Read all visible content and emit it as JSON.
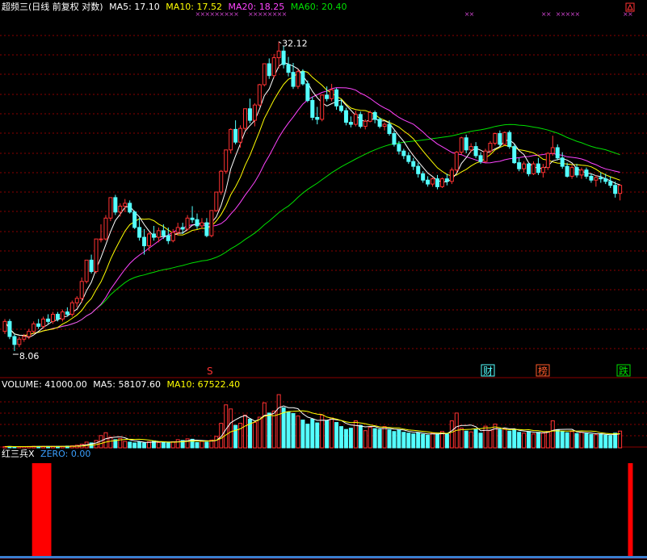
{
  "header": {
    "stock_title": "超频三(日线 前复权 对数)",
    "ma5_label": "MA5: 17.10",
    "ma10_label": "MA10: 17.52",
    "ma20_label": "MA20: 18.25",
    "ma60_label": "MA60: 20.40"
  },
  "price_panel": {
    "high_label": "32.12",
    "low_label": "8.06",
    "markers": [
      {
        "text": "S"
      },
      {
        "text": "财"
      },
      {
        "text": "榜"
      },
      {
        "text": "跌"
      }
    ]
  },
  "volume_header": {
    "volume_label": "VOLUME: 41000.00",
    "ma5_label": "MA5: 58107.60",
    "ma10_label": "MA10: 67522.40"
  },
  "indicator_header": {
    "name": "红三兵",
    "close_mark": "X",
    "zero_label": "ZERO: 0.00"
  },
  "colors": {
    "up": "#ff3232",
    "down": "#54ffff",
    "ma5": "#ffffff",
    "ma10": "#ffff00",
    "ma20": "#ff44ff",
    "ma60": "#00e000",
    "grid": "#8b0000",
    "signal": "#ff0000",
    "zero_line": "#3a7fd0",
    "marker_purple": "#cc44cc"
  },
  "chart_data": {
    "type": "candlestick",
    "scale": "log",
    "ylim": [
      7.5,
      36
    ],
    "candles": [
      [
        8.8,
        9.3,
        8.7,
        9.2
      ],
      [
        9.2,
        9.3,
        8.5,
        8.6
      ],
      [
        8.6,
        8.7,
        8.06,
        8.3
      ],
      [
        8.3,
        8.6,
        8.2,
        8.5
      ],
      [
        8.5,
        8.7,
        8.4,
        8.6
      ],
      [
        8.6,
        8.9,
        8.5,
        8.8
      ],
      [
        8.8,
        9.2,
        8.7,
        9.1
      ],
      [
        9.1,
        9.3,
        8.9,
        9.0
      ],
      [
        9.0,
        9.4,
        8.9,
        9.3
      ],
      [
        9.3,
        9.5,
        9.1,
        9.2
      ],
      [
        9.2,
        9.6,
        9.1,
        9.5
      ],
      [
        9.5,
        9.6,
        9.2,
        9.3
      ],
      [
        9.3,
        9.7,
        9.2,
        9.6
      ],
      [
        9.6,
        9.8,
        9.4,
        9.5
      ],
      [
        9.5,
        10.1,
        9.4,
        10.0
      ],
      [
        10.0,
        10.3,
        9.8,
        10.2
      ],
      [
        10.2,
        11.2,
        10.0,
        11.0
      ],
      [
        11.0,
        12.1,
        10.9,
        12.1
      ],
      [
        12.1,
        12.4,
        11.4,
        11.5
      ],
      [
        11.5,
        13.3,
        11.4,
        13.3
      ],
      [
        13.3,
        14.2,
        13.1,
        13.3
      ],
      [
        13.3,
        14.8,
        13.2,
        14.6
      ],
      [
        14.6,
        16.0,
        14.4,
        16.0
      ],
      [
        16.0,
        16.2,
        14.8,
        15.0
      ],
      [
        15.0,
        15.6,
        14.7,
        15.4
      ],
      [
        15.4,
        15.9,
        15.0,
        15.6
      ],
      [
        15.6,
        15.8,
        14.9,
        15.0
      ],
      [
        15.0,
        15.1,
        13.9,
        14.0
      ],
      [
        14.0,
        14.6,
        13.2,
        13.4
      ],
      [
        13.4,
        13.9,
        12.4,
        12.9
      ],
      [
        12.9,
        13.7,
        12.6,
        13.6
      ],
      [
        13.6,
        14.1,
        13.2,
        13.4
      ],
      [
        13.4,
        14.0,
        13.1,
        13.8
      ],
      [
        13.8,
        14.2,
        13.3,
        13.5
      ],
      [
        13.5,
        14.0,
        13.0,
        13.2
      ],
      [
        13.2,
        13.9,
        13.1,
        13.7
      ],
      [
        13.7,
        14.3,
        13.5,
        14.0
      ],
      [
        14.0,
        14.3,
        13.6,
        13.9
      ],
      [
        13.9,
        14.8,
        13.8,
        14.6
      ],
      [
        14.6,
        15.4,
        14.3,
        14.5
      ],
      [
        14.5,
        14.9,
        13.9,
        14.1
      ],
      [
        14.1,
        14.6,
        13.9,
        14.3
      ],
      [
        14.3,
        14.6,
        13.4,
        13.5
      ],
      [
        13.5,
        15.1,
        13.4,
        15.1
      ],
      [
        15.1,
        16.4,
        15.0,
        16.4
      ],
      [
        16.4,
        18.1,
        16.2,
        18.0
      ],
      [
        18.0,
        19.8,
        17.8,
        19.8
      ],
      [
        19.8,
        21.8,
        19.5,
        21.7
      ],
      [
        21.7,
        22.6,
        20.3,
        20.5
      ],
      [
        20.5,
        22.1,
        20.0,
        21.8
      ],
      [
        21.8,
        23.8,
        21.6,
        23.8
      ],
      [
        23.8,
        24.9,
        22.3,
        22.6
      ],
      [
        22.6,
        24.4,
        22.0,
        24.2
      ],
      [
        24.2,
        26.6,
        24.0,
        26.5
      ],
      [
        26.5,
        29.1,
        26.3,
        29.1
      ],
      [
        29.1,
        29.8,
        27.2,
        27.6
      ],
      [
        27.6,
        30.4,
        27.3,
        29.9
      ],
      [
        29.9,
        32.12,
        28.5,
        30.8
      ],
      [
        30.8,
        31.5,
        28.5,
        29.0
      ],
      [
        29.0,
        30.0,
        27.5,
        28.0
      ],
      [
        28.0,
        29.2,
        26.0,
        26.3
      ],
      [
        26.3,
        28.4,
        26.0,
        28.1
      ],
      [
        28.1,
        28.4,
        26.4,
        26.6
      ],
      [
        26.6,
        27.0,
        24.5,
        24.7
      ],
      [
        24.7,
        25.1,
        22.6,
        22.9
      ],
      [
        22.9,
        24.0,
        22.2,
        22.7
      ],
      [
        22.7,
        25.4,
        22.5,
        25.3
      ],
      [
        25.3,
        26.3,
        24.6,
        24.9
      ],
      [
        24.9,
        26.6,
        24.6,
        25.9
      ],
      [
        25.9,
        26.1,
        23.7,
        24.1
      ],
      [
        24.1,
        24.8,
        23.4,
        23.6
      ],
      [
        23.6,
        23.9,
        22.1,
        22.4
      ],
      [
        22.4,
        23.0,
        21.9,
        22.2
      ],
      [
        22.2,
        23.6,
        22.0,
        23.2
      ],
      [
        23.2,
        23.5,
        21.8,
        22.0
      ],
      [
        22.0,
        22.7,
        21.7,
        22.5
      ],
      [
        22.5,
        23.6,
        22.4,
        23.4
      ],
      [
        23.4,
        23.6,
        22.3,
        22.7
      ],
      [
        22.7,
        22.9,
        21.8,
        22.0
      ],
      [
        22.0,
        22.4,
        21.6,
        22.2
      ],
      [
        22.2,
        22.6,
        21.1,
        21.3
      ],
      [
        21.3,
        21.6,
        20.1,
        20.3
      ],
      [
        20.3,
        20.6,
        19.4,
        19.7
      ],
      [
        19.7,
        19.9,
        19.0,
        19.3
      ],
      [
        19.3,
        19.6,
        18.6,
        18.8
      ],
      [
        18.8,
        19.1,
        18.1,
        18.4
      ],
      [
        18.4,
        18.7,
        17.5,
        17.8
      ],
      [
        17.8,
        18.0,
        17.1,
        17.3
      ],
      [
        17.3,
        17.6,
        16.8,
        17.0
      ],
      [
        17.0,
        17.5,
        16.8,
        17.4
      ],
      [
        17.4,
        17.7,
        16.6,
        16.8
      ],
      [
        16.8,
        17.5,
        16.7,
        17.4
      ],
      [
        17.4,
        17.8,
        16.9,
        17.2
      ],
      [
        17.2,
        18.3,
        17.0,
        18.1
      ],
      [
        18.1,
        19.7,
        17.9,
        19.6
      ],
      [
        19.6,
        21.0,
        19.4,
        20.9
      ],
      [
        20.9,
        21.2,
        19.5,
        19.8
      ],
      [
        19.8,
        20.4,
        19.6,
        20.1
      ],
      [
        20.1,
        20.5,
        19.1,
        19.3
      ],
      [
        19.3,
        19.6,
        18.6,
        18.8
      ],
      [
        18.8,
        19.9,
        18.7,
        19.7
      ],
      [
        19.7,
        20.6,
        19.5,
        20.4
      ],
      [
        20.4,
        21.4,
        20.2,
        21.3
      ],
      [
        21.3,
        21.6,
        20.1,
        20.3
      ],
      [
        20.3,
        21.5,
        20.2,
        21.4
      ],
      [
        21.4,
        21.6,
        19.9,
        20.1
      ],
      [
        20.1,
        20.3,
        18.6,
        18.7
      ],
      [
        18.7,
        19.1,
        18.0,
        18.2
      ],
      [
        18.2,
        18.8,
        17.9,
        18.6
      ],
      [
        18.6,
        18.7,
        17.6,
        17.8
      ],
      [
        17.8,
        18.8,
        17.7,
        18.6
      ],
      [
        18.6,
        19.1,
        17.7,
        17.9
      ],
      [
        17.9,
        18.6,
        17.5,
        18.3
      ],
      [
        18.3,
        19.6,
        18.1,
        19.5
      ],
      [
        19.5,
        21.1,
        19.3,
        20.0
      ],
      [
        20.0,
        20.3,
        18.9,
        19.1
      ],
      [
        19.1,
        19.6,
        18.2,
        18.4
      ],
      [
        18.4,
        18.7,
        17.5,
        17.6
      ],
      [
        17.6,
        18.5,
        17.4,
        18.3
      ],
      [
        18.3,
        18.6,
        17.5,
        17.7
      ],
      [
        17.7,
        18.3,
        17.4,
        18.1
      ],
      [
        18.1,
        18.3,
        17.4,
        17.6
      ],
      [
        17.6,
        17.8,
        17.1,
        17.3
      ],
      [
        17.3,
        17.7,
        16.8,
        17.5
      ],
      [
        17.5,
        17.9,
        17.1,
        17.4
      ],
      [
        17.4,
        17.8,
        17.0,
        17.2
      ],
      [
        17.2,
        17.6,
        16.7,
        16.9
      ],
      [
        16.9,
        17.2,
        16.0,
        16.3
      ],
      [
        16.3,
        17.0,
        15.8,
        16.9
      ]
    ],
    "ma_periods": {
      "ma5": 5,
      "ma10": 10,
      "ma20": 20,
      "ma60": 60
    },
    "volume": {
      "ylim": [
        0,
        140000
      ],
      "values": [
        3000,
        3200,
        2800,
        2600,
        3000,
        3300,
        3600,
        3400,
        3500,
        3300,
        3600,
        3400,
        3800,
        4200,
        5000,
        6500,
        9000,
        14000,
        12000,
        18000,
        30000,
        37000,
        26000,
        20000,
        23000,
        16000,
        14000,
        12000,
        14000,
        12000,
        15000,
        17000,
        13000,
        14000,
        12000,
        15000,
        20000,
        18000,
        22000,
        21000,
        13000,
        16000,
        14000,
        19000,
        28000,
        60000,
        105000,
        95000,
        55000,
        60000,
        80000,
        70000,
        62000,
        75000,
        110000,
        85000,
        90000,
        130000,
        98000,
        88000,
        84000,
        78000,
        68000,
        58000,
        70000,
        61000,
        80000,
        67000,
        73000,
        62000,
        52000,
        45000,
        48000,
        66000,
        55000,
        42000,
        50000,
        47000,
        45000,
        52000,
        44000,
        40000,
        44000,
        38000,
        36000,
        34000,
        37000,
        33000,
        31000,
        36000,
        33000,
        40000,
        34000,
        66000,
        85000,
        48000,
        41000,
        39000,
        45000,
        36000,
        53000,
        42000,
        58000,
        44000,
        47000,
        41000,
        44000,
        38000,
        36000,
        40000,
        34000,
        38000,
        36000,
        40000,
        66000,
        44000,
        40000,
        37000,
        40000,
        35000,
        38000,
        35000,
        33000,
        32000,
        34000,
        31000,
        30000,
        36000,
        41000
      ],
      "ma5_value": 58107.6,
      "ma10_value": 67522.4
    },
    "indicator": {
      "name": "红三兵",
      "zero": 0.0,
      "signal_candle_ranges": [
        [
          6,
          10
        ],
        [
          130,
          131
        ]
      ]
    }
  }
}
